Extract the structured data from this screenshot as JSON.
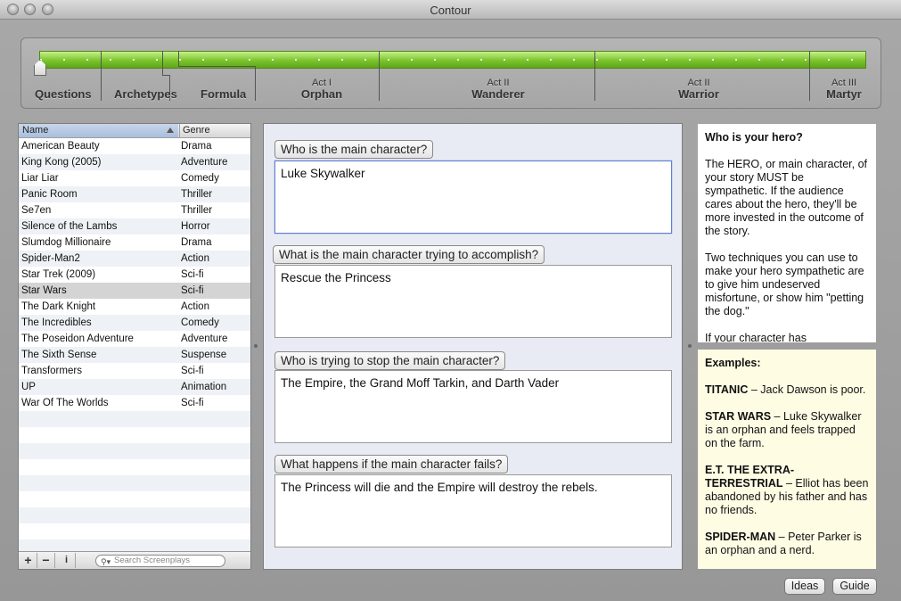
{
  "window": {
    "title": "Contour"
  },
  "timeline": {
    "sections": [
      "Questions",
      "Archetypes",
      "Formula"
    ],
    "acts": [
      {
        "act": "Act I",
        "name": "Orphan"
      },
      {
        "act": "Act II",
        "name": "Wanderer"
      },
      {
        "act": "Act II",
        "name": "Warrior"
      },
      {
        "act": "Act III",
        "name": "Martyr"
      }
    ]
  },
  "table": {
    "columns": {
      "name": "Name",
      "genre": "Genre"
    },
    "rows": [
      {
        "name": "American Beauty",
        "genre": "Drama"
      },
      {
        "name": "King Kong (2005)",
        "genre": "Adventure"
      },
      {
        "name": "Liar Liar",
        "genre": "Comedy"
      },
      {
        "name": "Panic Room",
        "genre": "Thriller"
      },
      {
        "name": "Se7en",
        "genre": "Thriller"
      },
      {
        "name": "Silence of the Lambs",
        "genre": "Horror"
      },
      {
        "name": "Slumdog Millionaire",
        "genre": "Drama"
      },
      {
        "name": "Spider-Man2",
        "genre": "Action"
      },
      {
        "name": "Star Trek (2009)",
        "genre": "Sci-fi"
      },
      {
        "name": "Star Wars",
        "genre": "Sci-fi"
      },
      {
        "name": "The Dark Knight",
        "genre": "Action"
      },
      {
        "name": "The Incredibles",
        "genre": "Comedy"
      },
      {
        "name": "The Poseidon Adventure",
        "genre": "Adventure"
      },
      {
        "name": "The Sixth Sense",
        "genre": "Suspense"
      },
      {
        "name": "Transformers",
        "genre": "Sci-fi"
      },
      {
        "name": "UP",
        "genre": "Animation"
      },
      {
        "name": "War Of The Worlds",
        "genre": "Sci-fi"
      }
    ],
    "selected": "Star Wars",
    "footer": {
      "add": "+",
      "remove": "−",
      "info": "i",
      "search_placeholder": "Search Screenplays"
    }
  },
  "questions": [
    {
      "label": "Who is the main character?",
      "answer": "Luke Skywalker"
    },
    {
      "label": "What is the main character trying to accomplish?",
      "answer": "Rescue the Princess"
    },
    {
      "label": "Who is trying to stop the main character?",
      "answer": "The Empire, the Grand Moff Tarkin, and Darth Vader"
    },
    {
      "label": "What happens if the main character fails?",
      "answer": "The Princess will die and the Empire will destroy the rebels."
    }
  ],
  "help": {
    "heading": "Who is your hero?",
    "p1": "The HERO, or main character, of your story MUST be sympathetic. If the audience cares about the hero, they'll be more invested in the outcome of the story.",
    "p2": "Two techniques you can use to make your hero sympathetic are to give him undeserved misfortune, or show him \"petting the dog.\"",
    "p3": "If your character has"
  },
  "examples": {
    "heading": "Examples:",
    "items": [
      {
        "title": "TITANIC",
        "text": " – Jack Dawson is poor."
      },
      {
        "title": "STAR WARS",
        "text": " – Luke Skywalker is an orphan and feels trapped on the farm."
      },
      {
        "title": "E.T. THE EXTRA-TERRESTRIAL",
        "text": " – Elliot has been abandoned by his father and has no friends."
      },
      {
        "title": "SPIDER-MAN",
        "text": " – Peter Parker is an orphan and a nerd."
      }
    ]
  },
  "buttons": {
    "ideas": "Ideas",
    "guide": "Guide"
  }
}
